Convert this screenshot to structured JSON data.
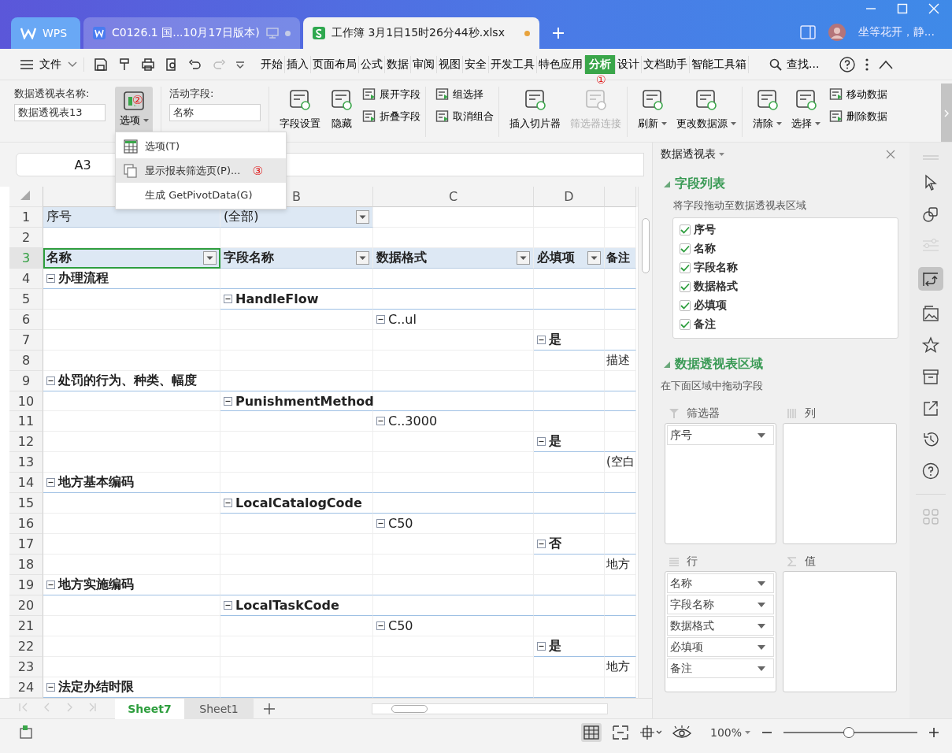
{
  "title_tabs": [
    {
      "label": "WPS",
      "kind": "home",
      "selected": false
    },
    {
      "label": "C0126.1 国...10月17日版本)",
      "kind": "doc",
      "selected": false,
      "color": "#c5cce6"
    },
    {
      "label": "工作簿 3月1日15时26分44秒.xlsx",
      "kind": "sheet",
      "selected": true,
      "color": "#e8a33d"
    }
  ],
  "user_name": "坐等花开，静...",
  "file_menu": "文件",
  "menu_tabs": [
    {
      "label": "开始",
      "selected": false
    },
    {
      "label": "插入",
      "selected": false
    },
    {
      "label": "页面布局",
      "selected": false
    },
    {
      "label": "公式",
      "selected": false
    },
    {
      "label": "数据",
      "selected": false
    },
    {
      "label": "审阅",
      "selected": false
    },
    {
      "label": "视图",
      "selected": false
    },
    {
      "label": "安全",
      "selected": false
    },
    {
      "label": "开发工具",
      "selected": false
    },
    {
      "label": "特色应用",
      "selected": false
    },
    {
      "label": "分析",
      "selected": true,
      "badge": "①"
    },
    {
      "label": "设计",
      "selected": false
    },
    {
      "label": "文档助手",
      "selected": false
    },
    {
      "label": "智能工具箱",
      "selected": false
    }
  ],
  "search": "查找...",
  "ribbon": {
    "pivot_name_label": "数据透视表名称:",
    "pivot_name": "数据透视表13",
    "options_button": {
      "label": "选项",
      "pressed": true,
      "badge": "②"
    },
    "active_field_label": "活动字段:",
    "active_field": "名称",
    "groups": [
      [
        {
          "label": "字段设置",
          "kind": "large",
          "dropdown": false,
          "disabled": false
        },
        {
          "label": "隐藏",
          "kind": "large",
          "dropdown": false,
          "disabled": false
        },
        {
          "label": "展开字段",
          "kind": "small",
          "dropdown": false,
          "disabled": false
        },
        {
          "label": "折叠字段",
          "kind": "small",
          "dropdown": false,
          "disabled": false
        }
      ],
      [
        {
          "label": "组选择",
          "kind": "small",
          "dropdown": false,
          "disabled": false
        },
        {
          "label": "取消组合",
          "kind": "small",
          "dropdown": false,
          "disabled": false
        }
      ],
      [
        {
          "label": "插入切片器",
          "kind": "large",
          "dropdown": false,
          "disabled": false
        },
        {
          "label": "筛选器连接",
          "kind": "large",
          "dropdown": false,
          "disabled": true
        }
      ],
      [
        {
          "label": "刷新",
          "kind": "large",
          "dropdown": true,
          "disabled": false
        },
        {
          "label": "更改数据源",
          "kind": "large",
          "dropdown": true,
          "disabled": false
        }
      ],
      [
        {
          "label": "清除",
          "kind": "large",
          "dropdown": true,
          "disabled": false
        },
        {
          "label": "选择",
          "kind": "large",
          "dropdown": true,
          "disabled": false
        },
        {
          "label": "移动数据",
          "kind": "small",
          "dropdown": false,
          "disabled": false
        },
        {
          "label": "删除数据",
          "kind": "small",
          "dropdown": false,
          "disabled": false
        }
      ]
    ]
  },
  "options_menu": [
    {
      "label": "选项(T)",
      "hovered": false
    },
    {
      "label": "显示报表筛选页(P)...",
      "hovered": true,
      "badge": "③"
    },
    {
      "label": "生成 GetPivotData(G)",
      "hovered": false
    }
  ],
  "name_box": "A3",
  "column_headers": [
    "B",
    "C",
    "D"
  ],
  "rows": [
    {
      "number": "1",
      "selected": false,
      "cells": [
        {
          "text": "序号",
          "kind": "field"
        },
        {
          "text": "(全部)",
          "kind": "filter",
          "dropdown": true
        },
        null,
        null,
        null
      ]
    },
    {
      "number": "2",
      "selected": false,
      "cells": [
        null,
        null,
        null,
        null,
        null
      ]
    },
    {
      "number": "3",
      "selected": true,
      "cells": [
        {
          "text": "名称",
          "kind": "header",
          "dropdown": true
        },
        {
          "text": "字段名称",
          "kind": "header",
          "dropdown": true
        },
        {
          "text": "数据格式",
          "kind": "header",
          "dropdown": true
        },
        {
          "text": "必填项",
          "kind": "header",
          "dropdown": true
        },
        {
          "text": "备注",
          "kind": "header",
          "dropdown": false
        }
      ]
    },
    {
      "number": "4",
      "selected": false,
      "cells": [
        {
          "text": "办理流程",
          "kind": "group"
        },
        null,
        null,
        null,
        null
      ]
    },
    {
      "number": "5",
      "selected": false,
      "cells": [
        null,
        {
          "text": "HandleFlow",
          "kind": "group"
        },
        null,
        null,
        null
      ]
    },
    {
      "number": "6",
      "selected": false,
      "cells": [
        null,
        null,
        {
          "text": "C..ul",
          "kind": "item"
        },
        null,
        null
      ]
    },
    {
      "number": "7",
      "selected": false,
      "cells": [
        null,
        null,
        null,
        {
          "text": "是",
          "kind": "group"
        },
        null
      ]
    },
    {
      "number": "8",
      "selected": false,
      "cells": [
        null,
        null,
        null,
        null,
        {
          "text": "描述",
          "kind": "text"
        }
      ]
    },
    {
      "number": "9",
      "selected": false,
      "cells": [
        {
          "text": "处罚的行为、种类、幅度",
          "kind": "group"
        },
        null,
        null,
        null,
        null
      ]
    },
    {
      "number": "10",
      "selected": false,
      "cells": [
        null,
        {
          "text": "PunishmentMethod",
          "kind": "group"
        },
        null,
        null,
        null
      ]
    },
    {
      "number": "11",
      "selected": false,
      "cells": [
        null,
        null,
        {
          "text": "C..3000",
          "kind": "item"
        },
        null,
        null
      ]
    },
    {
      "number": "12",
      "selected": false,
      "cells": [
        null,
        null,
        null,
        {
          "text": "是",
          "kind": "group"
        },
        null
      ]
    },
    {
      "number": "13",
      "selected": false,
      "cells": [
        null,
        null,
        null,
        null,
        {
          "text": "(空白",
          "kind": "text"
        }
      ]
    },
    {
      "number": "14",
      "selected": false,
      "cells": [
        {
          "text": "地方基本编码",
          "kind": "group"
        },
        null,
        null,
        null,
        null
      ]
    },
    {
      "number": "15",
      "selected": false,
      "cells": [
        null,
        {
          "text": "LocalCatalogCode",
          "kind": "group"
        },
        null,
        null,
        null
      ]
    },
    {
      "number": "16",
      "selected": false,
      "cells": [
        null,
        null,
        {
          "text": "C50",
          "kind": "item"
        },
        null,
        null
      ]
    },
    {
      "number": "17",
      "selected": false,
      "cells": [
        null,
        null,
        null,
        {
          "text": "否",
          "kind": "group"
        },
        null
      ]
    },
    {
      "number": "18",
      "selected": false,
      "cells": [
        null,
        null,
        null,
        null,
        {
          "text": "地方",
          "kind": "text"
        }
      ]
    },
    {
      "number": "19",
      "selected": false,
      "cells": [
        {
          "text": "地方实施编码",
          "kind": "group"
        },
        null,
        null,
        null,
        null
      ]
    },
    {
      "number": "20",
      "selected": false,
      "cells": [
        null,
        {
          "text": "LocalTaskCode",
          "kind": "group"
        },
        null,
        null,
        null
      ]
    },
    {
      "number": "21",
      "selected": false,
      "cells": [
        null,
        null,
        {
          "text": "C50",
          "kind": "item"
        },
        null,
        null
      ]
    },
    {
      "number": "22",
      "selected": false,
      "cells": [
        null,
        null,
        null,
        {
          "text": "是",
          "kind": "group"
        },
        null
      ]
    },
    {
      "number": "23",
      "selected": false,
      "cells": [
        null,
        null,
        null,
        null,
        {
          "text": "地方",
          "kind": "text"
        }
      ]
    },
    {
      "number": "24",
      "selected": false,
      "cells": [
        {
          "text": "法定办结时限",
          "kind": "group"
        },
        null,
        null,
        null,
        null
      ]
    }
  ],
  "sheet_tabs": [
    {
      "label": "Sheet7",
      "selected": true
    },
    {
      "label": "Sheet1",
      "selected": false
    }
  ],
  "pivot_panel": {
    "title": "数据透视表",
    "field_list_title": "字段列表",
    "field_list_hint": "将字段拖动至数据透视表区域",
    "fields": [
      {
        "label": "序号",
        "checked": true
      },
      {
        "label": "名称",
        "checked": true
      },
      {
        "label": "字段名称",
        "checked": true
      },
      {
        "label": "数据格式",
        "checked": true
      },
      {
        "label": "必填项",
        "checked": true
      },
      {
        "label": "备注",
        "checked": true
      }
    ],
    "areas_title": "数据透视表区域",
    "areas_hint": "在下面区域中拖动字段",
    "areas": [
      {
        "label": "筛选器",
        "kind": "filter",
        "items": [
          "序号"
        ]
      },
      {
        "label": "列",
        "kind": "columns"
      },
      {
        "label": "行",
        "kind": "rows",
        "items": [
          "名称",
          "字段名称",
          "数据格式",
          "必填项",
          "备注"
        ]
      },
      {
        "label": "值",
        "kind": "values"
      }
    ]
  },
  "status_bar": {
    "zoom": "100%",
    "zoom_slider": {
      "level": 0.49
    }
  }
}
